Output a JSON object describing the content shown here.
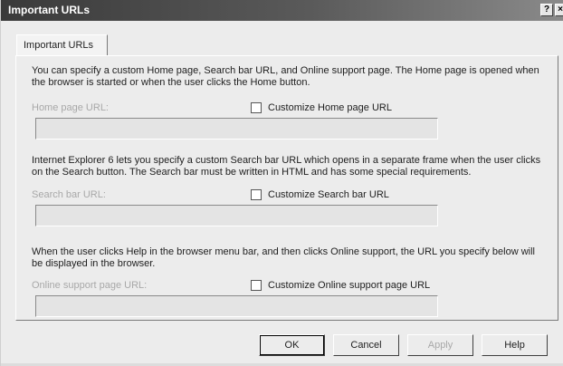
{
  "window": {
    "title": "Important URLs",
    "help_glyph": "?",
    "close_glyph": "×"
  },
  "tab": {
    "label": "Important URLs"
  },
  "sections": {
    "home": {
      "description": "You can specify a custom Home page, Search bar URL, and Online support page. The Home page is opened when the browser is started or when the user clicks the Home button.",
      "field_label": "Home page URL:",
      "checkbox_label": "Customize Home page URL",
      "checked": false,
      "value": ""
    },
    "search": {
      "description": "Internet Explorer 6 lets you specify a custom Search bar URL which opens in a separate frame when the user clicks on the Search button. The Search bar must be written in HTML and has some special requirements.",
      "field_label": "Search bar URL:",
      "checkbox_label": "Customize Search bar URL",
      "checked": false,
      "value": ""
    },
    "support": {
      "description": "When the user clicks Help in the browser menu bar, and then clicks Online support, the URL you specify below will be displayed in the browser.",
      "field_label": "Online support page URL:",
      "checkbox_label": "Customize Online support page URL",
      "checked": false,
      "value": ""
    }
  },
  "buttons": {
    "ok": "OK",
    "cancel": "Cancel",
    "apply": "Apply",
    "help": "Help"
  }
}
